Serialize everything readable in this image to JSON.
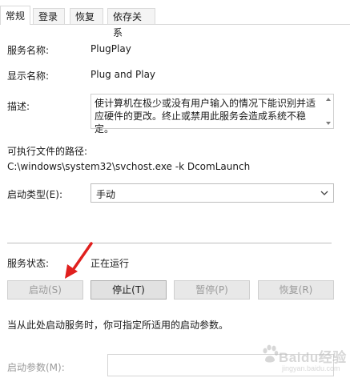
{
  "tabs": [
    {
      "label": "常规",
      "active": true
    },
    {
      "label": "登录",
      "active": false
    },
    {
      "label": "恢复",
      "active": false
    },
    {
      "label": "依存关系",
      "active": false
    }
  ],
  "service_name": {
    "label": "服务名称:",
    "value": "PlugPlay"
  },
  "display_name": {
    "label": "显示名称:",
    "value": "Plug and Play"
  },
  "description": {
    "label": "描述:",
    "text": "使计算机在极少或没有用户输入的情况下能识别并适应硬件的更改。终止或禁用此服务会造成系统不稳定。"
  },
  "exec_path": {
    "label": "可执行文件的路径:",
    "value": "C:\\windows\\system32\\svchost.exe -k DcomLaunch"
  },
  "startup_type": {
    "label": "启动类型(E):",
    "value": "手动"
  },
  "service_status": {
    "label": "服务状态:",
    "value": "正在运行"
  },
  "buttons": {
    "start": {
      "label": "启动(S)",
      "enabled": false
    },
    "stop": {
      "label": "停止(T)",
      "enabled": true
    },
    "pause": {
      "label": "暂停(P)",
      "enabled": false
    },
    "resume": {
      "label": "恢复(R)",
      "enabled": false
    }
  },
  "hint": "当从此处启动服务时，你可指定所适用的启动参数。",
  "start_params": {
    "label": "启动参数(M):",
    "value": ""
  },
  "watermark": {
    "brand": "Baidu经验",
    "url": "jingyan.baidu.com"
  },
  "colors": {
    "annotation_arrow": "#e0201e",
    "disabled_text": "#9a9a9a"
  },
  "icons": {
    "scroll_up": "scroll-up-arrow-icon",
    "scroll_down": "scroll-down-arrow-icon",
    "dropdown": "chevron-down-icon",
    "annotation": "red-arrow-annotation",
    "watermark": "baidu-paw-icon"
  }
}
